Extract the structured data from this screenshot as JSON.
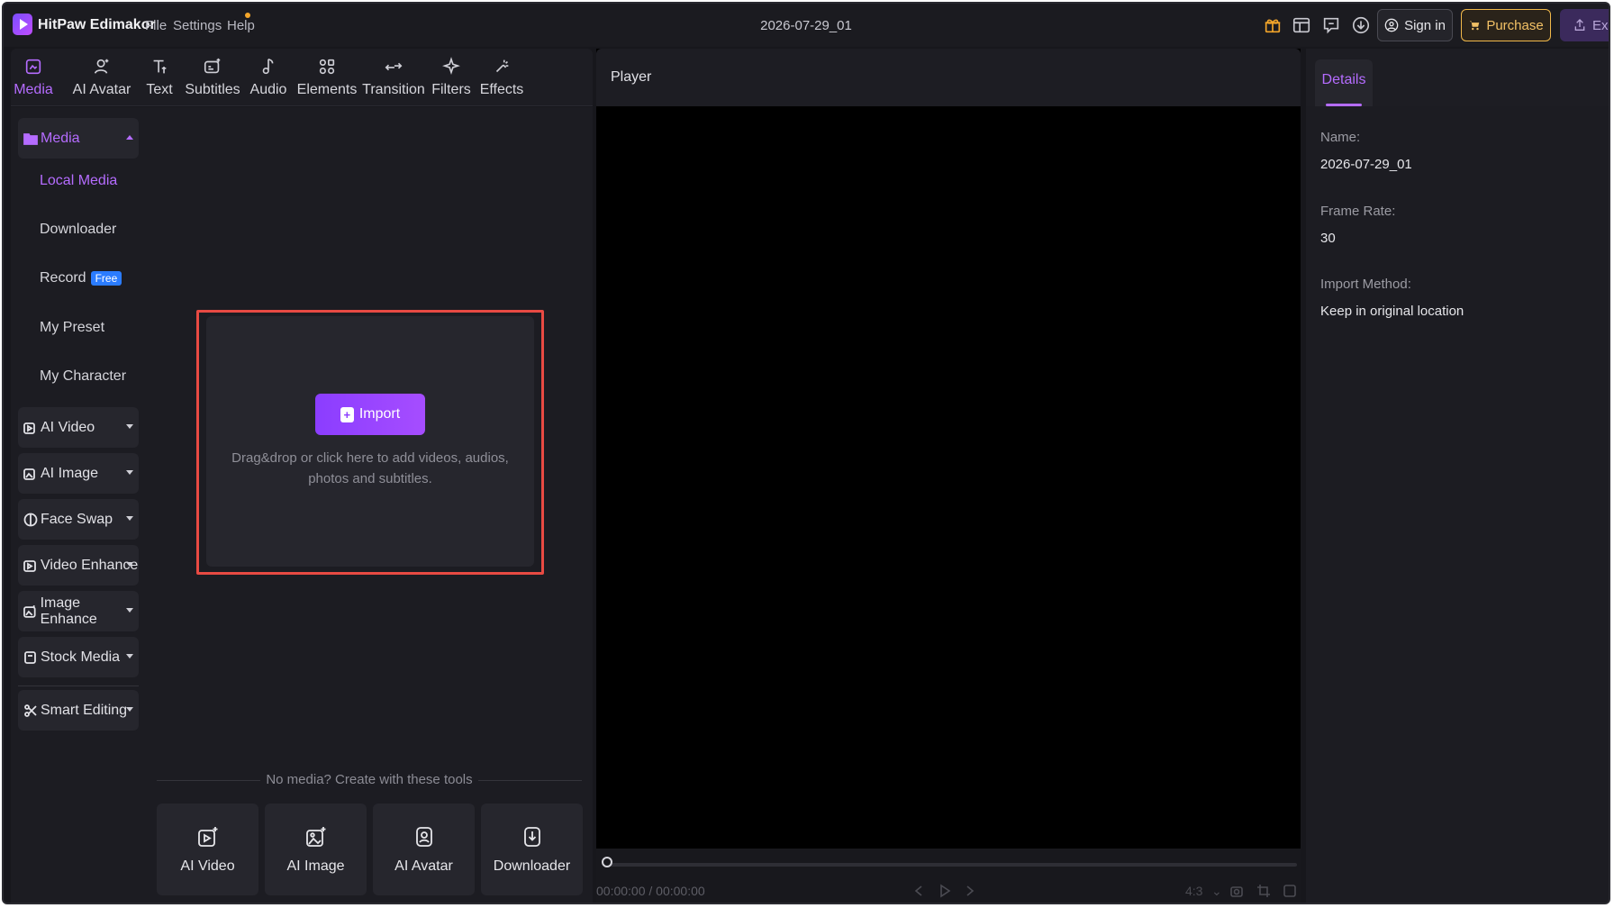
{
  "app": {
    "name": "HitPaw Edimakor",
    "project_title": "2026-07-29_01"
  },
  "menu": [
    "File",
    "Settings",
    "Help"
  ],
  "topbar": {
    "sign_in": "Sign in",
    "purchase": "Purchase",
    "export": "Exp"
  },
  "tool_tabs": [
    {
      "label": "Media",
      "icon": "media-icon",
      "active": true
    },
    {
      "label": "AI Avatar",
      "icon": "ai-avatar-icon"
    },
    {
      "label": "Text",
      "icon": "text-icon"
    },
    {
      "label": "Subtitles",
      "icon": "subtitles-icon"
    },
    {
      "label": "Audio",
      "icon": "audio-icon"
    },
    {
      "label": "Elements",
      "icon": "elements-icon"
    },
    {
      "label": "Transition",
      "icon": "transition-icon"
    },
    {
      "label": "Filters",
      "icon": "filters-icon"
    },
    {
      "label": "Effects",
      "icon": "effects-icon"
    }
  ],
  "sidebar": {
    "media_group": "Media",
    "sub_items": [
      "Local Media",
      "Downloader",
      "Record",
      "My Preset",
      "My Character"
    ],
    "record_badge": "Free",
    "groups": [
      "AI Video",
      "AI Image",
      "Face Swap",
      "Video Enhance",
      "Image Enhance",
      "Stock Media",
      "Smart Editing"
    ]
  },
  "media_panel": {
    "import_label": "Import",
    "import_hint": "Drag&drop or click here to add videos, audios, photos and subtitles.",
    "no_media_text": "No media? Create with these tools",
    "create_tools": [
      "AI Video",
      "AI Image",
      "AI Avatar",
      "Downloader"
    ]
  },
  "player": {
    "title": "Player",
    "timecode": "00:00:00 / 00:00:00",
    "aspect": "4:3"
  },
  "details": {
    "tab": "Details",
    "name_label": "Name:",
    "name_value": "2026-07-29_01",
    "frame_rate_label": "Frame Rate:",
    "frame_rate_value": "30",
    "import_method_label": "Import Method:",
    "import_method_value": "Keep in original location"
  },
  "colors": {
    "accent": "#b56cff",
    "import_button": "#8b3dff",
    "highlight_border": "#e84a43",
    "purchase": "#f0b84a",
    "free_badge": "#2b7cff"
  }
}
